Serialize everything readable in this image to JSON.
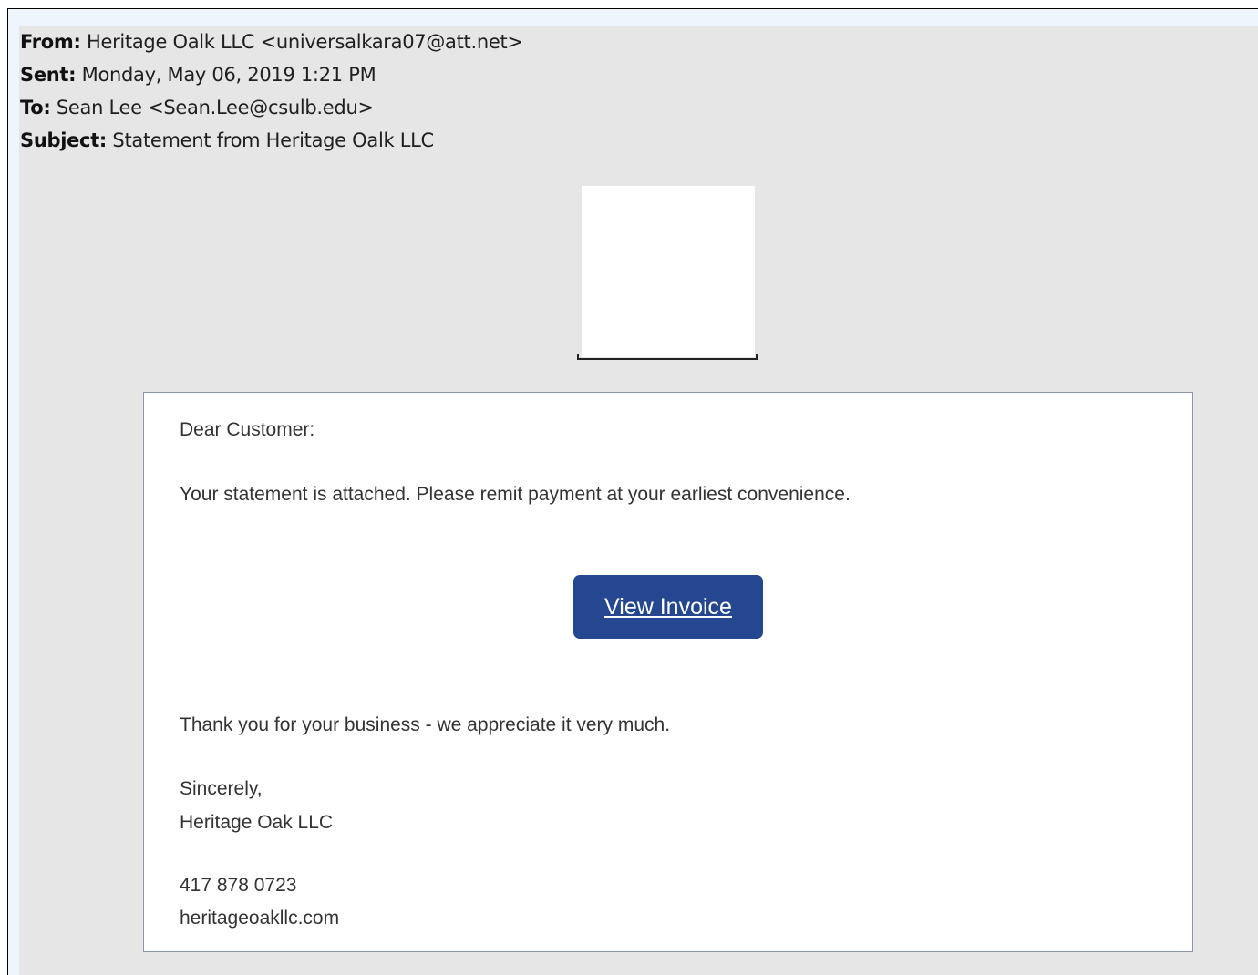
{
  "email": {
    "headers": {
      "from_label": "From:",
      "from_value": " Heritage Oalk LLC <universalkara07@att.net>",
      "sent_label": "Sent:",
      "sent_value": " Monday, May 06, 2019 1:21 PM",
      "to_label": "To:",
      "to_value": " Sean Lee <Sean.Lee@csulb.edu>",
      "subject_label": "Subject:",
      "subject_value": " Statement from Heritage Oalk LLC"
    },
    "body": {
      "greeting": "Dear Customer:",
      "message": "Your statement is attached. Please remit payment at your earliest convenience.",
      "button_label": "View Invoice",
      "thanks": "Thank you for your business - we appreciate it very much.",
      "closing": "Sincerely,",
      "company": "Heritage Oak LLC",
      "phone": "417 878 0723",
      "website": "heritageoakllc.com"
    },
    "colors": {
      "button_bg": "#25478f",
      "page_bg": "#e6e6e6"
    }
  }
}
